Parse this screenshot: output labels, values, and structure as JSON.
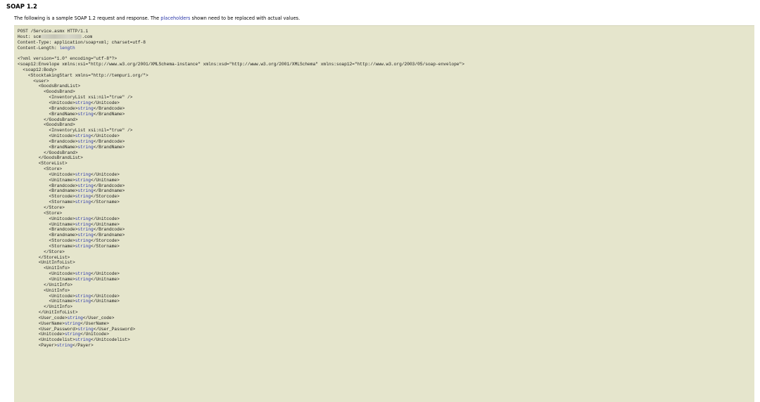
{
  "heading": "SOAP 1.2",
  "intro": {
    "before": "The following is a sample SOAP 1.2 request and response. The ",
    "link": "placeholders",
    "after": " shown need to be replaced with actual values."
  },
  "code_lines": [
    [
      {
        "t": "POST /Service.asmx HTTP/1.1"
      }
    ],
    [
      {
        "t": "Host: scm"
      },
      {
        "blur": true
      },
      {
        "t": ".com"
      }
    ],
    [
      {
        "t": "Content-Type: application/soap+xml; charset=utf-8"
      }
    ],
    [
      {
        "t": "Content-Length: "
      },
      {
        "t": "length",
        "ph": true
      }
    ],
    [
      {
        "t": ""
      }
    ],
    [
      {
        "t": "<?xml version=\"1.0\" encoding=\"utf-8\"?>"
      }
    ],
    [
      {
        "t": "<soap12:Envelope xmlns:xsi=\"http://www.w3.org/2001/XMLSchema-instance\" xmlns:xsd=\"http://www.w3.org/2001/XMLSchema\" xmlns:soap12=\"http://www.w3.org/2003/05/soap-envelope\">"
      }
    ],
    [
      {
        "t": "  <soap12:Body>"
      }
    ],
    [
      {
        "t": "    <StocktakingStart xmlns=\"http://tempuri.org/\">"
      }
    ],
    [
      {
        "t": "      <user>"
      }
    ],
    [
      {
        "t": "        <GoodsBrandList>"
      }
    ],
    [
      {
        "t": "          <GoodsBrand>"
      }
    ],
    [
      {
        "t": "            <InventoryList xsi:nil=\"true\" />"
      }
    ],
    [
      {
        "t": "            <Unitcode>"
      },
      {
        "t": "string",
        "ph": true
      },
      {
        "t": "</Unitcode>"
      }
    ],
    [
      {
        "t": "            <Brandcode>"
      },
      {
        "t": "string",
        "ph": true
      },
      {
        "t": "</Brandcode>"
      }
    ],
    [
      {
        "t": "            <BrandName>"
      },
      {
        "t": "string",
        "ph": true
      },
      {
        "t": "</BrandName>"
      }
    ],
    [
      {
        "t": "          </GoodsBrand>"
      }
    ],
    [
      {
        "t": "          <GoodsBrand>"
      }
    ],
    [
      {
        "t": "            <InventoryList xsi:nil=\"true\" />"
      }
    ],
    [
      {
        "t": "            <Unitcode>"
      },
      {
        "t": "string",
        "ph": true
      },
      {
        "t": "</Unitcode>"
      }
    ],
    [
      {
        "t": "            <Brandcode>"
      },
      {
        "t": "string",
        "ph": true
      },
      {
        "t": "</Brandcode>"
      }
    ],
    [
      {
        "t": "            <BrandName>"
      },
      {
        "t": "string",
        "ph": true
      },
      {
        "t": "</BrandName>"
      }
    ],
    [
      {
        "t": "          </GoodsBrand>"
      }
    ],
    [
      {
        "t": "        </GoodsBrandList>"
      }
    ],
    [
      {
        "t": "        <StoreList>"
      }
    ],
    [
      {
        "t": "          <Store>"
      }
    ],
    [
      {
        "t": "            <Unitcode>"
      },
      {
        "t": "string",
        "ph": true
      },
      {
        "t": "</Unitcode>"
      }
    ],
    [
      {
        "t": "            <Unitname>"
      },
      {
        "t": "string",
        "ph": true
      },
      {
        "t": "</Unitname>"
      }
    ],
    [
      {
        "t": "            <Brandcode>"
      },
      {
        "t": "string",
        "ph": true
      },
      {
        "t": "</Brandcode>"
      }
    ],
    [
      {
        "t": "            <Brandname>"
      },
      {
        "t": "string",
        "ph": true
      },
      {
        "t": "</Brandname>"
      }
    ],
    [
      {
        "t": "            <Storcode>"
      },
      {
        "t": "string",
        "ph": true
      },
      {
        "t": "</Storcode>"
      }
    ],
    [
      {
        "t": "            <Storname>"
      },
      {
        "t": "string",
        "ph": true
      },
      {
        "t": "</Storname>"
      }
    ],
    [
      {
        "t": "          </Store>"
      }
    ],
    [
      {
        "t": "          <Store>"
      }
    ],
    [
      {
        "t": "            <Unitcode>"
      },
      {
        "t": "string",
        "ph": true
      },
      {
        "t": "</Unitcode>"
      }
    ],
    [
      {
        "t": "            <Unitname>"
      },
      {
        "t": "string",
        "ph": true
      },
      {
        "t": "</Unitname>"
      }
    ],
    [
      {
        "t": "            <Brandcode>"
      },
      {
        "t": "string",
        "ph": true
      },
      {
        "t": "</Brandcode>"
      }
    ],
    [
      {
        "t": "            <Brandname>"
      },
      {
        "t": "string",
        "ph": true
      },
      {
        "t": "</Brandname>"
      }
    ],
    [
      {
        "t": "            <Storcode>"
      },
      {
        "t": "string",
        "ph": true
      },
      {
        "t": "</Storcode>"
      }
    ],
    [
      {
        "t": "            <Storname>"
      },
      {
        "t": "string",
        "ph": true
      },
      {
        "t": "</Storname>"
      }
    ],
    [
      {
        "t": "          </Store>"
      }
    ],
    [
      {
        "t": "        </StoreList>"
      }
    ],
    [
      {
        "t": "        <UnitInfoList>"
      }
    ],
    [
      {
        "t": "          <UnitInfo>"
      }
    ],
    [
      {
        "t": "            <Unitcode>"
      },
      {
        "t": "string",
        "ph": true
      },
      {
        "t": "</Unitcode>"
      }
    ],
    [
      {
        "t": "            <Unitname>"
      },
      {
        "t": "string",
        "ph": true
      },
      {
        "t": "</Unitname>"
      }
    ],
    [
      {
        "t": "          </UnitInfo>"
      }
    ],
    [
      {
        "t": "          <UnitInfo>"
      }
    ],
    [
      {
        "t": "            <Unitcode>"
      },
      {
        "t": "string",
        "ph": true
      },
      {
        "t": "</Unitcode>"
      }
    ],
    [
      {
        "t": "            <Unitname>"
      },
      {
        "t": "string",
        "ph": true
      },
      {
        "t": "</Unitname>"
      }
    ],
    [
      {
        "t": "          </UnitInfo>"
      }
    ],
    [
      {
        "t": "        </UnitInfoList>"
      }
    ],
    [
      {
        "t": "        <User_code>"
      },
      {
        "t": "string",
        "ph": true
      },
      {
        "t": "</User_code>"
      }
    ],
    [
      {
        "t": "        <UserName>"
      },
      {
        "t": "string",
        "ph": true
      },
      {
        "t": "</UserName>"
      }
    ],
    [
      {
        "t": "        <User_Password>"
      },
      {
        "t": "string",
        "ph": true
      },
      {
        "t": "</User_Password>"
      }
    ],
    [
      {
        "t": "        <Unitcode>"
      },
      {
        "t": "string",
        "ph": true
      },
      {
        "t": "</Unitcode>"
      }
    ],
    [
      {
        "t": "        <Unitcodelist>"
      },
      {
        "t": "string",
        "ph": true
      },
      {
        "t": "</Unitcodelist>"
      }
    ],
    [
      {
        "t": "        <Payer>"
      },
      {
        "t": "string",
        "ph": true
      },
      {
        "t": "</Payer>"
      }
    ]
  ]
}
